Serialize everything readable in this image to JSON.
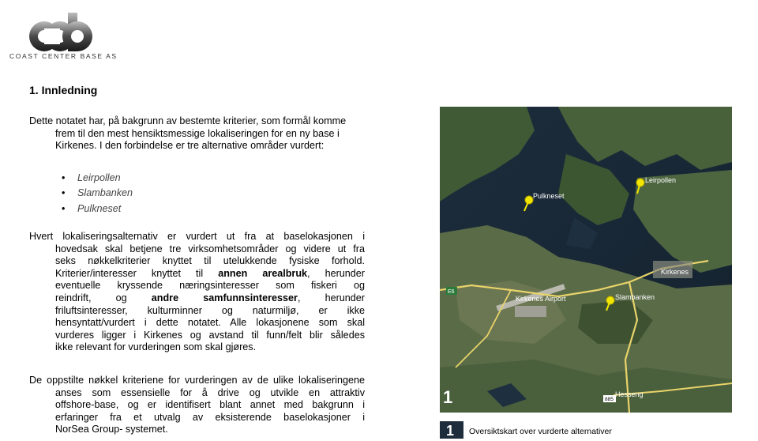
{
  "logo": {
    "mark": "cdb",
    "tagline": "COAST CENTER BASE AS"
  },
  "heading": "1. Innledning",
  "intro": [
    "Dette notatet har, på bakgrunn av bestemte kriterier, som formål komme",
    "frem til den mest hensiktsmessige lokaliseringen for en ny base i",
    "Kirkenes. I den forbindelse er tre alternative områder vurdert:"
  ],
  "bullets": [
    "Leirpollen",
    "Slambanken",
    "Pulkneset"
  ],
  "para2": {
    "l1": "Hvert lokaliseringsalternativ er vurdert ut fra at baselokasjonen i",
    "l2": "hovedsak skal  betjene tre virksomhetsområder og videre ut fra",
    "l3": "seks nøkkelkriterier knyttet til utelukkende fysiske forhold.",
    "l4a": "Kriterier/interesser knyttet til ",
    "l4b": "annen arealbruk",
    "l4c": ", herunder",
    "l5": "eventuelle kryssende næringsinteresser som fiskeri og",
    "l6a": "reindrift, og ",
    "l6b": "andre samfunnsinteresser",
    "l6c": ", herunder",
    "l7": "friluftsinteresser, kulturminner og naturmiljø, er ikke",
    "l8": "hensyntatt/vurdert i dette notatet. Alle lokasjonene som skal",
    "l9": "vurderes ligger i Kirkenes og avstand til funn/felt blir således",
    "l10": "ikke relevant for vurderingen som skal gjøres."
  },
  "para3": [
    "De oppstilte nøkkel kriteriene for vurderingen av de ulike lokaliseringene",
    "anses som essensielle for å drive og utvikle en attraktiv",
    "offshore-base, og er identifisert blant annet med bakgrunn i",
    "erfaringer fra   et utvalg av eksisterende baselokasjoner i",
    "NorSea Group- systemet."
  ],
  "map": {
    "labels": {
      "pulkneset": "Pulkneset",
      "leirpollen": "Leirpollen",
      "kirkenes": "Kirkenes",
      "airport": "Kirkenes Airport",
      "slambanken": "Slambanken",
      "hesseng": "Hesseng",
      "road_e6": "E6",
      "road_885": "885",
      "figure_number": "1"
    },
    "pin_color": "#f2e600",
    "road_color": "#e8d36a"
  },
  "caption": {
    "number": "1",
    "text": "Oversiktskart over vurderte alternativer"
  }
}
